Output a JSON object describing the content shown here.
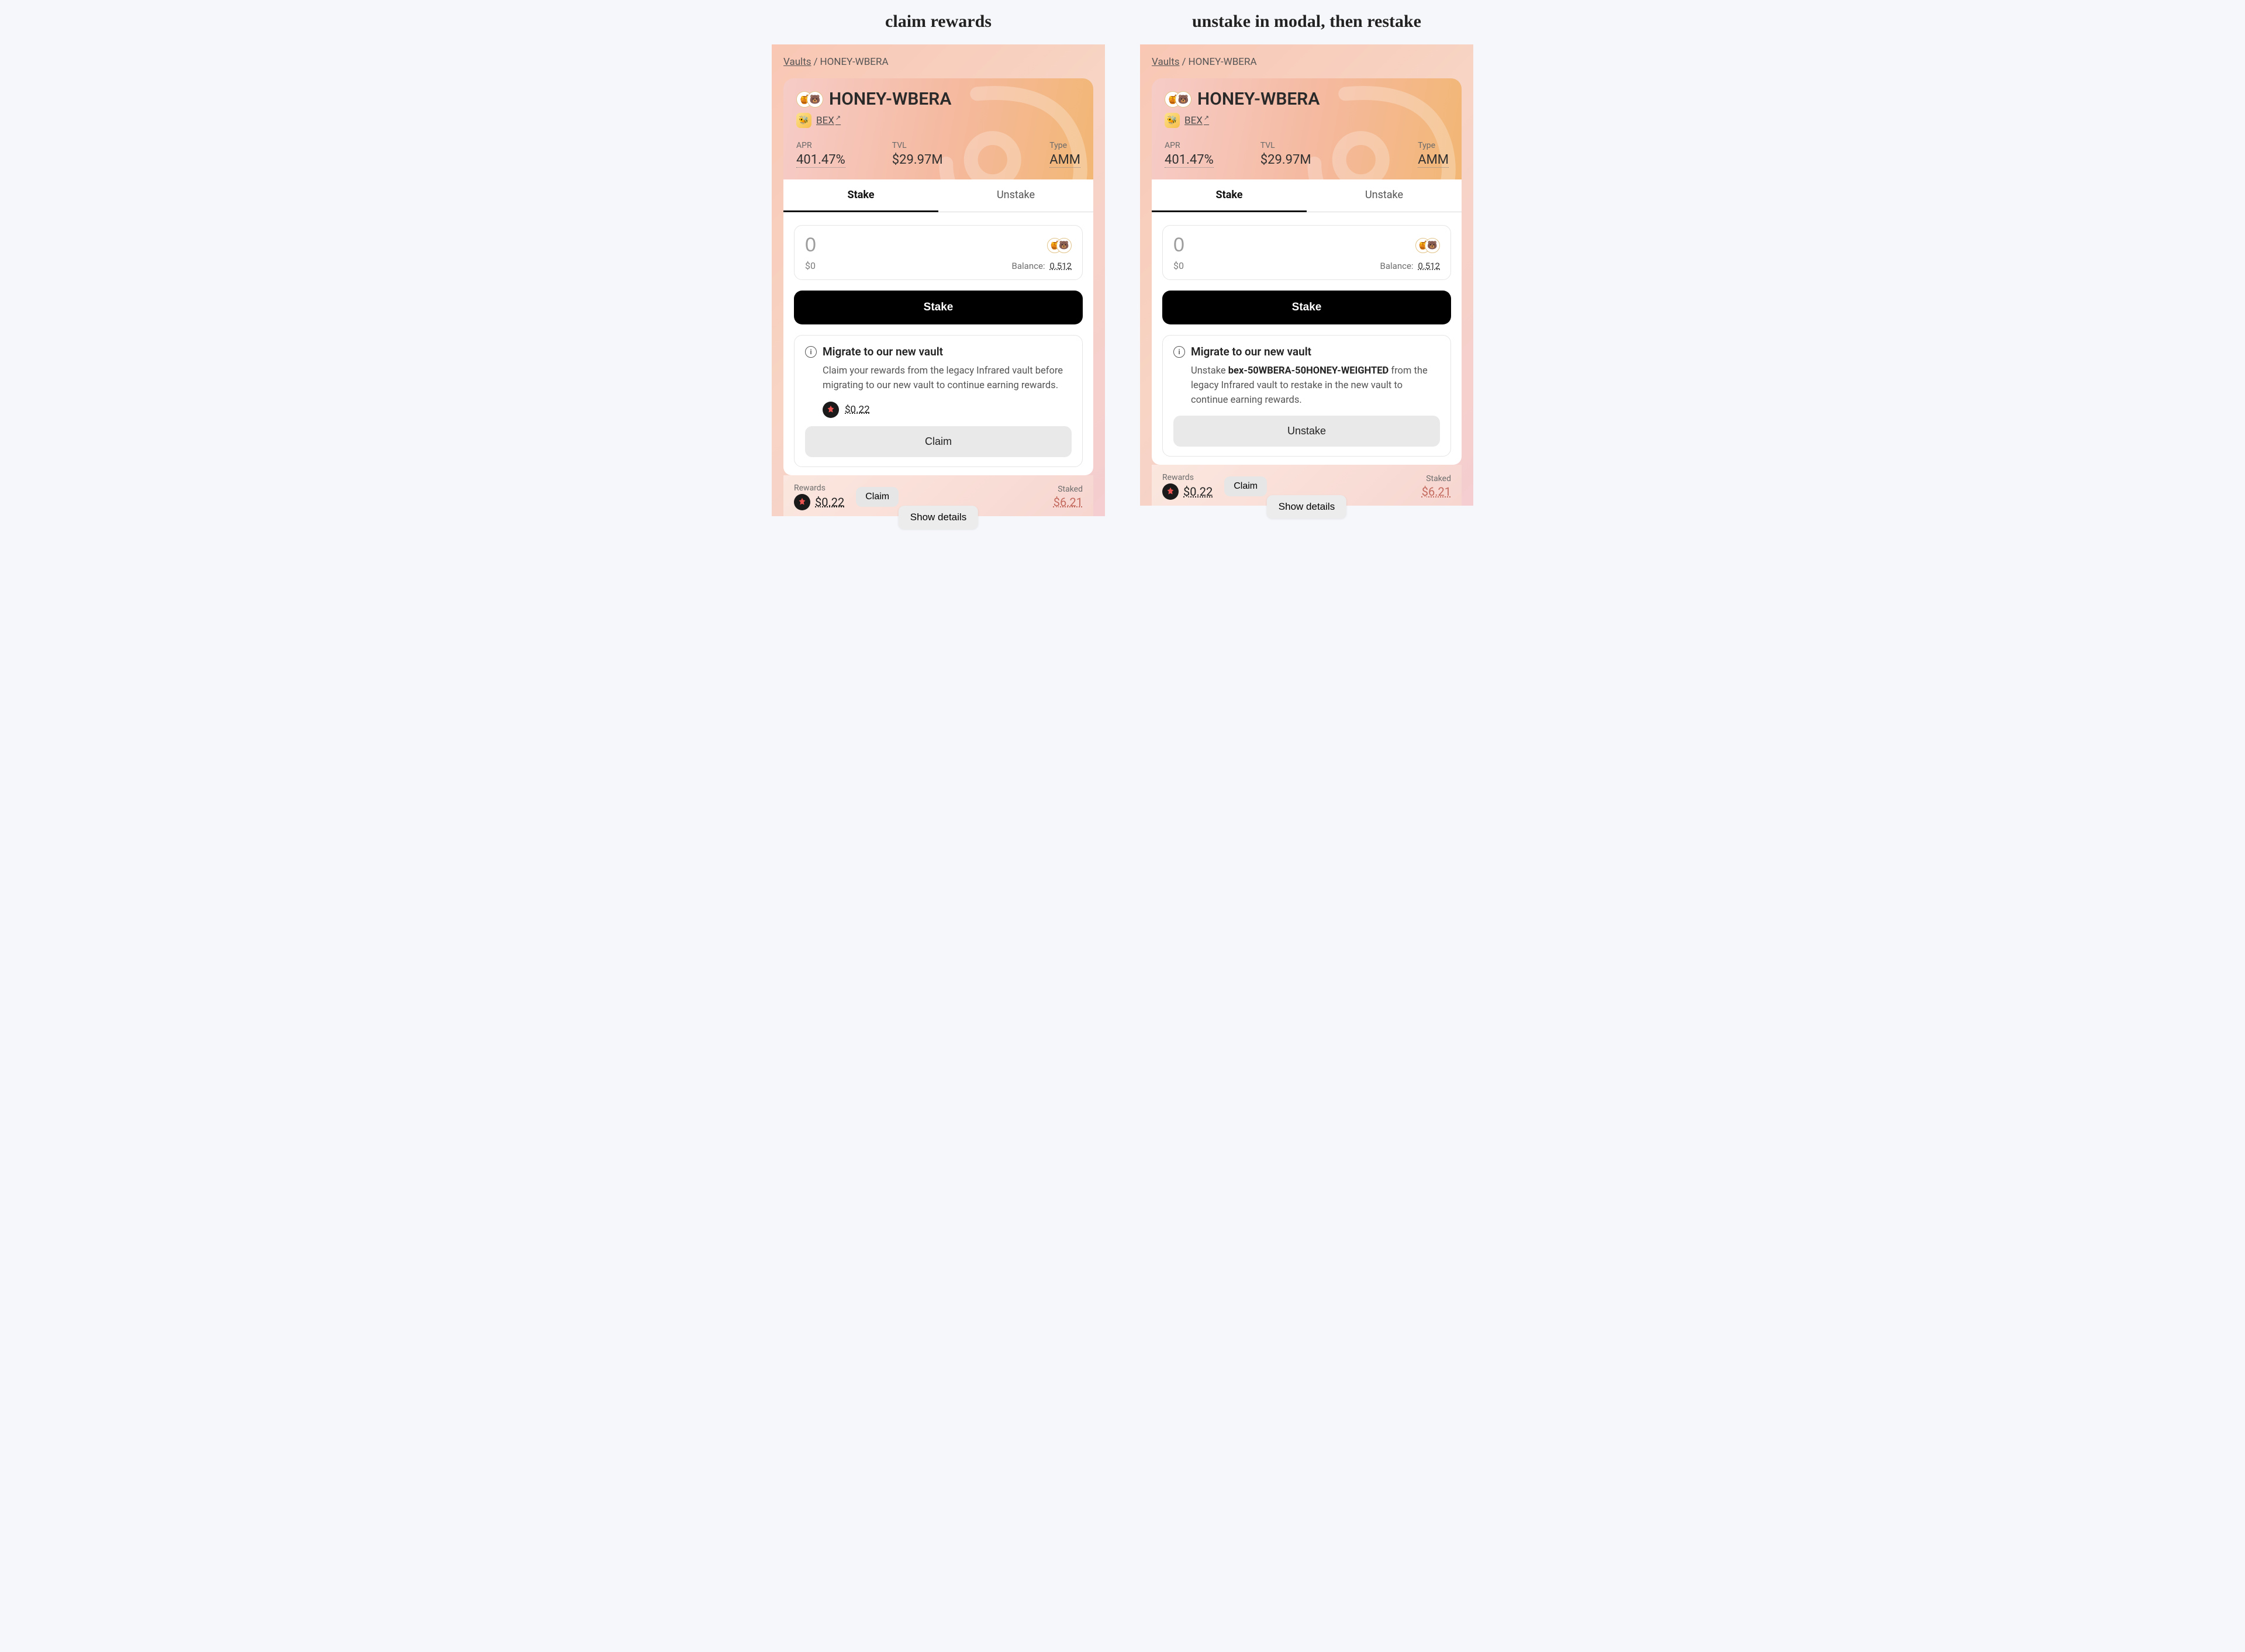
{
  "left": {
    "heading": "claim rewards",
    "breadcrumb": {
      "root": "Vaults",
      "current": "HONEY-WBERA"
    },
    "vault": {
      "name": "HONEY-WBERA",
      "exchange": "BEX",
      "apr_label": "APR",
      "apr": "401.47%",
      "tvl_label": "TVL",
      "tvl": "$29.97M",
      "type_label": "Type",
      "type": "AMM"
    },
    "tabs": {
      "stake": "Stake",
      "unstake": "Unstake",
      "active": "stake"
    },
    "input": {
      "amount": "0",
      "fiat": "$0",
      "balance_label": "Balance:",
      "balance": "0.512"
    },
    "primary": "Stake",
    "migrate": {
      "title": "Migrate to our new vault",
      "body_plain": "Claim your rewards from the legacy Infrared vault before migrating to our new vault to continue earning rewards.",
      "reward_amount": "$0.22",
      "action": "Claim"
    },
    "footer": {
      "rewards_label": "Rewards",
      "rewards_value": "$0.22",
      "claim": "Claim",
      "staked_label": "Staked",
      "staked_value": "$6.21",
      "show_details": "Show details"
    }
  },
  "right": {
    "heading": "unstake in modal, then restake",
    "breadcrumb": {
      "root": "Vaults",
      "current": "HONEY-WBERA"
    },
    "vault": {
      "name": "HONEY-WBERA",
      "exchange": "BEX",
      "apr_label": "APR",
      "apr": "401.47%",
      "tvl_label": "TVL",
      "tvl": "$29.97M",
      "type_label": "Type",
      "type": "AMM"
    },
    "tabs": {
      "stake": "Stake",
      "unstake": "Unstake",
      "active": "stake"
    },
    "input": {
      "amount": "0",
      "fiat": "$0",
      "balance_label": "Balance:",
      "balance": "0.512"
    },
    "primary": "Stake",
    "migrate": {
      "title": "Migrate to our new vault",
      "body_prefix": "Unstake ",
      "body_bold": "bex-50WBERA-50HONEY-WEIGHTED",
      "body_suffix": " from the legacy Infrared vault to restake in the new vault to continue earning rewards.",
      "action": "Unstake"
    },
    "footer": {
      "rewards_label": "Rewards",
      "rewards_value": "$0.22",
      "claim": "Claim",
      "staked_label": "Staked",
      "staked_value": "$6.21",
      "show_details": "Show details"
    }
  }
}
